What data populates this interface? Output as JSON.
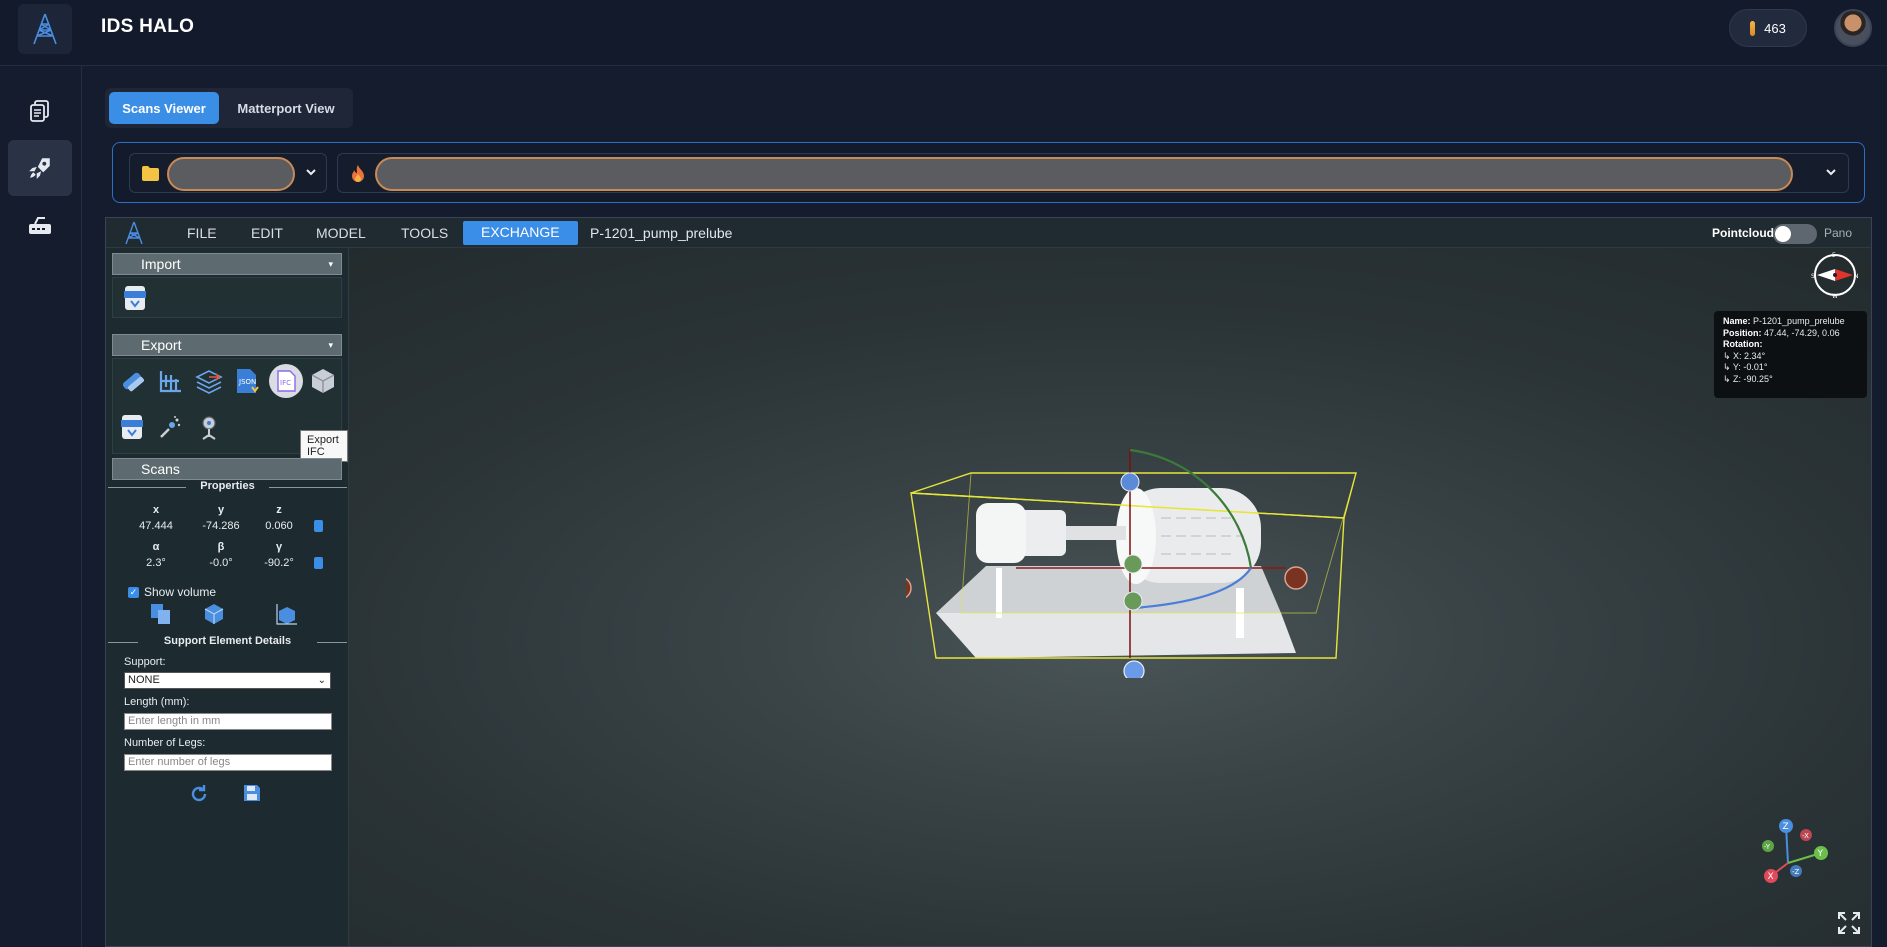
{
  "app": {
    "title": "IDS HALO",
    "credits": "463"
  },
  "tabs": [
    {
      "label": "Scans Viewer"
    },
    {
      "label": "Matterport View"
    }
  ],
  "viewer": {
    "menu": {
      "file": "FILE",
      "edit": "EDIT",
      "model": "MODEL",
      "tools": "TOOLS",
      "exchange": "EXCHANGE"
    },
    "file_name": "P-1201_pump_prelube",
    "pointcloud_label": "Pointcloud",
    "pano_label": "Pano"
  },
  "panel": {
    "import_label": "Import",
    "export_label": "Export",
    "scans_label": "Scans",
    "tooltip": "Export IFC",
    "properties_title": "Properties",
    "pos": {
      "x_label": "x",
      "y_label": "y",
      "z_label": "z",
      "x": "47.444",
      "y": "-74.286",
      "z": "0.060"
    },
    "rot": {
      "a_label": "α",
      "b_label": "β",
      "g_label": "γ",
      "a": "2.3°",
      "b": "-0.0°",
      "g": "-90.2°"
    },
    "show_volume": "Show volume",
    "support_title": "Support Element Details",
    "support_label": "Support:",
    "support_value": "NONE",
    "length_label": "Length (mm):",
    "length_placeholder": "Enter length in mm",
    "legs_label": "Number of Legs:",
    "legs_placeholder": "Enter number of legs"
  },
  "info": {
    "name_label": "Name:",
    "name": "P-1201_pump_prelube",
    "position_label": "Position:",
    "position": "47.44, -74.29, 0.06",
    "rotation_label": "Rotation:",
    "rx": "X: 2.34°",
    "ry": "Y: -0.01°",
    "rz": "Z: -90.25°"
  },
  "colors": {
    "accent": "#3a8ee6",
    "highlight": "#c98a55"
  }
}
